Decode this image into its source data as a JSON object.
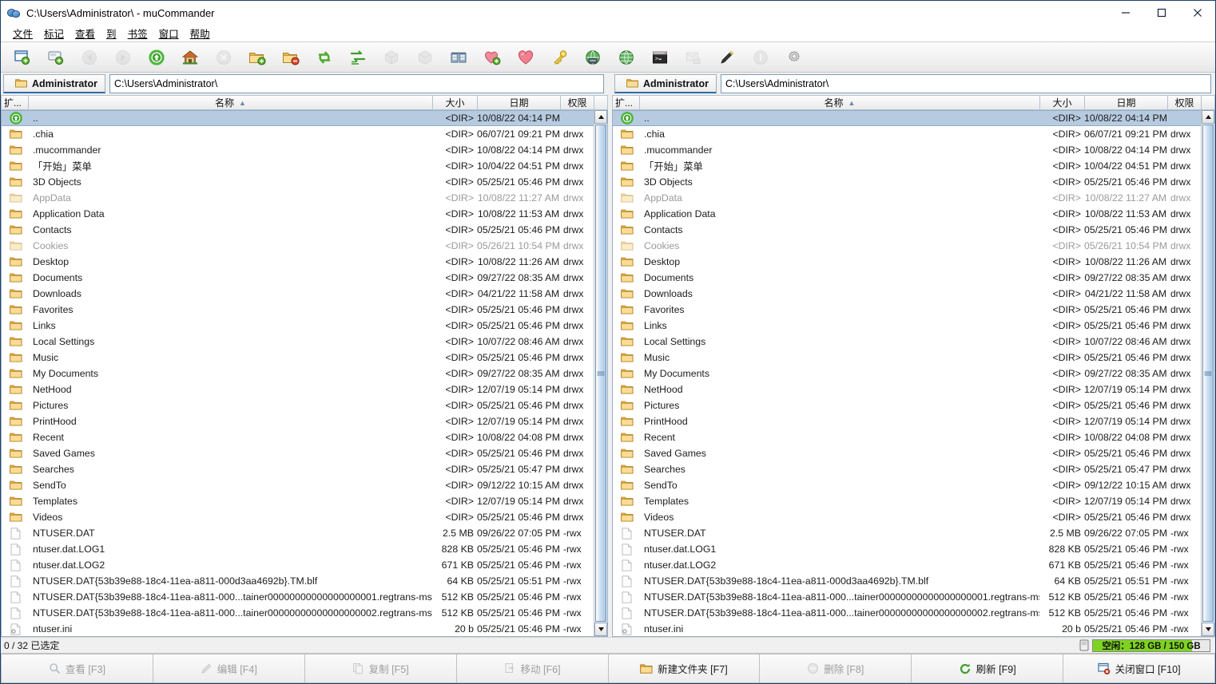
{
  "window": {
    "title": "C:\\Users\\Administrator\\ - muCommander",
    "icon": "mucommander-logo-icon",
    "controls": [
      {
        "name": "minimize-button",
        "glyph": "—"
      },
      {
        "name": "maximize-button",
        "glyph": "▢"
      },
      {
        "name": "close-button",
        "glyph": "✕"
      }
    ]
  },
  "menubar": {
    "items": [
      {
        "name": "menu-file",
        "label": "文件"
      },
      {
        "name": "menu-mark",
        "label": "标记"
      },
      {
        "name": "menu-view",
        "label": "查看"
      },
      {
        "name": "menu-goto",
        "label": "到"
      },
      {
        "name": "menu-bookmarks",
        "label": "书签"
      },
      {
        "name": "menu-window",
        "label": "窗口"
      },
      {
        "name": "menu-help",
        "label": "帮助"
      }
    ]
  },
  "toolbar": {
    "items": [
      {
        "name": "new-window-icon",
        "tip": "新建窗口",
        "enabled": true
      },
      {
        "name": "new-tab-icon",
        "tip": "新建标签",
        "enabled": true
      },
      {
        "name": "back-icon",
        "tip": "后退",
        "enabled": false
      },
      {
        "name": "forward-icon",
        "tip": "前进",
        "enabled": false
      },
      {
        "name": "parent-folder-icon",
        "tip": "上级目录",
        "enabled": true
      },
      {
        "name": "home-icon",
        "tip": "主目录",
        "enabled": true
      },
      {
        "name": "stop-icon",
        "tip": "停止",
        "enabled": false
      },
      {
        "name": "mark-folder-icon",
        "tip": "标记",
        "enabled": true
      },
      {
        "name": "unmark-folder-icon",
        "tip": "取消标记",
        "enabled": true
      },
      {
        "name": "swap-panels-icon",
        "tip": "交换面板",
        "enabled": true
      },
      {
        "name": "set-same-folder-icon",
        "tip": "同步目录",
        "enabled": true
      },
      {
        "name": "pack-icon",
        "tip": "打包",
        "enabled": false
      },
      {
        "name": "unpack-icon",
        "tip": "解包",
        "enabled": false
      },
      {
        "name": "compare-folders-icon",
        "tip": "比较文件夹",
        "enabled": true
      },
      {
        "name": "add-bookmark-icon",
        "tip": "添加书签",
        "enabled": true
      },
      {
        "name": "edit-bookmarks-icon",
        "tip": "编辑书签",
        "enabled": true
      },
      {
        "name": "credentials-icon",
        "tip": "凭据",
        "enabled": true
      },
      {
        "name": "connect-server-icon",
        "tip": "连接服务器",
        "enabled": true
      },
      {
        "name": "show-server-icon",
        "tip": "服务器",
        "enabled": true
      },
      {
        "name": "terminal-icon",
        "tip": "终端",
        "enabled": true
      },
      {
        "name": "email-icon",
        "tip": "发送邮件",
        "enabled": false
      },
      {
        "name": "properties-icon",
        "tip": "属性",
        "enabled": true
      },
      {
        "name": "info-icon",
        "tip": "信息",
        "enabled": false
      },
      {
        "name": "preferences-icon",
        "tip": "首选项",
        "enabled": true
      }
    ]
  },
  "columns": {
    "ext": "扩...",
    "name": "名称",
    "size": "大小",
    "date": "日期",
    "perm": "权限",
    "sort_indicator": "▲"
  },
  "panels": [
    {
      "id": "left-panel",
      "tab_label": "Administrator",
      "path": "C:\\Users\\Administrator\\",
      "active": true
    },
    {
      "id": "right-panel",
      "tab_label": "Administrator",
      "path": "C:\\Users\\Administrator\\",
      "active": false
    }
  ],
  "files": [
    {
      "icon": "parent-folder-icon",
      "name": "..",
      "size": "<DIR>",
      "date": "10/08/22 04:14 PM",
      "perm": "",
      "hidden": false,
      "selected": true,
      "type": "dir"
    },
    {
      "icon": "folder-icon",
      "name": ".chia",
      "size": "<DIR>",
      "date": "06/07/21 09:21 PM",
      "perm": "drwx",
      "hidden": false,
      "selected": false,
      "type": "dir"
    },
    {
      "icon": "folder-icon",
      "name": ".mucommander",
      "size": "<DIR>",
      "date": "10/08/22 04:14 PM",
      "perm": "drwx",
      "hidden": false,
      "selected": false,
      "type": "dir"
    },
    {
      "icon": "folder-icon",
      "name": "「开始」菜单",
      "size": "<DIR>",
      "date": "10/04/22 04:51 PM",
      "perm": "drwx",
      "hidden": false,
      "selected": false,
      "type": "dir"
    },
    {
      "icon": "folder-icon",
      "name": "3D Objects",
      "size": "<DIR>",
      "date": "05/25/21 05:46 PM",
      "perm": "drwx",
      "hidden": false,
      "selected": false,
      "type": "dir"
    },
    {
      "icon": "folder-icon",
      "name": "AppData",
      "size": "<DIR>",
      "date": "10/08/22 11:27 AM",
      "perm": "drwx",
      "hidden": true,
      "selected": false,
      "type": "dir"
    },
    {
      "icon": "folder-icon",
      "name": "Application Data",
      "size": "<DIR>",
      "date": "10/08/22 11:53 AM",
      "perm": "drwx",
      "hidden": false,
      "selected": false,
      "type": "dir"
    },
    {
      "icon": "folder-icon",
      "name": "Contacts",
      "size": "<DIR>",
      "date": "05/25/21 05:46 PM",
      "perm": "drwx",
      "hidden": false,
      "selected": false,
      "type": "dir"
    },
    {
      "icon": "folder-icon",
      "name": "Cookies",
      "size": "<DIR>",
      "date": "05/26/21 10:54 PM",
      "perm": "drwx",
      "hidden": true,
      "selected": false,
      "type": "dir"
    },
    {
      "icon": "folder-icon",
      "name": "Desktop",
      "size": "<DIR>",
      "date": "10/08/22 11:26 AM",
      "perm": "drwx",
      "hidden": false,
      "selected": false,
      "type": "dir"
    },
    {
      "icon": "folder-icon",
      "name": "Documents",
      "size": "<DIR>",
      "date": "09/27/22 08:35 AM",
      "perm": "drwx",
      "hidden": false,
      "selected": false,
      "type": "dir"
    },
    {
      "icon": "folder-icon",
      "name": "Downloads",
      "size": "<DIR>",
      "date": "04/21/22 11:58 AM",
      "perm": "drwx",
      "hidden": false,
      "selected": false,
      "type": "dir"
    },
    {
      "icon": "folder-icon",
      "name": "Favorites",
      "size": "<DIR>",
      "date": "05/25/21 05:46 PM",
      "perm": "drwx",
      "hidden": false,
      "selected": false,
      "type": "dir"
    },
    {
      "icon": "folder-icon",
      "name": "Links",
      "size": "<DIR>",
      "date": "05/25/21 05:46 PM",
      "perm": "drwx",
      "hidden": false,
      "selected": false,
      "type": "dir"
    },
    {
      "icon": "folder-icon",
      "name": "Local Settings",
      "size": "<DIR>",
      "date": "10/07/22 08:46 AM",
      "perm": "drwx",
      "hidden": false,
      "selected": false,
      "type": "dir"
    },
    {
      "icon": "folder-icon",
      "name": "Music",
      "size": "<DIR>",
      "date": "05/25/21 05:46 PM",
      "perm": "drwx",
      "hidden": false,
      "selected": false,
      "type": "dir"
    },
    {
      "icon": "folder-icon",
      "name": "My Documents",
      "size": "<DIR>",
      "date": "09/27/22 08:35 AM",
      "perm": "drwx",
      "hidden": false,
      "selected": false,
      "type": "dir"
    },
    {
      "icon": "folder-icon",
      "name": "NetHood",
      "size": "<DIR>",
      "date": "12/07/19 05:14 PM",
      "perm": "drwx",
      "hidden": false,
      "selected": false,
      "type": "dir"
    },
    {
      "icon": "folder-icon",
      "name": "Pictures",
      "size": "<DIR>",
      "date": "05/25/21 05:46 PM",
      "perm": "drwx",
      "hidden": false,
      "selected": false,
      "type": "dir"
    },
    {
      "icon": "folder-icon",
      "name": "PrintHood",
      "size": "<DIR>",
      "date": "12/07/19 05:14 PM",
      "perm": "drwx",
      "hidden": false,
      "selected": false,
      "type": "dir"
    },
    {
      "icon": "folder-icon",
      "name": "Recent",
      "size": "<DIR>",
      "date": "10/08/22 04:08 PM",
      "perm": "drwx",
      "hidden": false,
      "selected": false,
      "type": "dir"
    },
    {
      "icon": "folder-icon",
      "name": "Saved Games",
      "size": "<DIR>",
      "date": "05/25/21 05:46 PM",
      "perm": "drwx",
      "hidden": false,
      "selected": false,
      "type": "dir"
    },
    {
      "icon": "folder-icon",
      "name": "Searches",
      "size": "<DIR>",
      "date": "05/25/21 05:47 PM",
      "perm": "drwx",
      "hidden": false,
      "selected": false,
      "type": "dir"
    },
    {
      "icon": "folder-icon",
      "name": "SendTo",
      "size": "<DIR>",
      "date": "09/12/22 10:15 AM",
      "perm": "drwx",
      "hidden": false,
      "selected": false,
      "type": "dir"
    },
    {
      "icon": "folder-icon",
      "name": "Templates",
      "size": "<DIR>",
      "date": "12/07/19 05:14 PM",
      "perm": "drwx",
      "hidden": false,
      "selected": false,
      "type": "dir"
    },
    {
      "icon": "folder-icon",
      "name": "Videos",
      "size": "<DIR>",
      "date": "05/25/21 05:46 PM",
      "perm": "drwx",
      "hidden": false,
      "selected": false,
      "type": "dir"
    },
    {
      "icon": "file-icon",
      "name": "NTUSER.DAT",
      "size": "2.5 MB",
      "date": "09/26/22 07:05 PM",
      "perm": "-rwx",
      "hidden": false,
      "selected": false,
      "type": "file"
    },
    {
      "icon": "file-icon",
      "name": "ntuser.dat.LOG1",
      "size": "828 KB",
      "date": "05/25/21 05:46 PM",
      "perm": "-rwx",
      "hidden": false,
      "selected": false,
      "type": "file"
    },
    {
      "icon": "file-icon",
      "name": "ntuser.dat.LOG2",
      "size": "671 KB",
      "date": "05/25/21 05:46 PM",
      "perm": "-rwx",
      "hidden": false,
      "selected": false,
      "type": "file"
    },
    {
      "icon": "file-icon",
      "name": "NTUSER.DAT{53b39e88-18c4-11ea-a811-000d3aa4692b}.TM.blf",
      "size": "64 KB",
      "date": "05/25/21 05:51 PM",
      "perm": "-rwx",
      "hidden": false,
      "selected": false,
      "type": "file"
    },
    {
      "icon": "file-icon",
      "name": "NTUSER.DAT{53b39e88-18c4-11ea-a811-000...tainer00000000000000000001.regtrans-ms",
      "size": "512 KB",
      "date": "05/25/21 05:46 PM",
      "perm": "-rwx",
      "hidden": false,
      "selected": false,
      "type": "file"
    },
    {
      "icon": "file-icon",
      "name": "NTUSER.DAT{53b39e88-18c4-11ea-a811-000...tainer00000000000000000002.regtrans-ms",
      "size": "512 KB",
      "date": "05/25/21 05:46 PM",
      "perm": "-rwx",
      "hidden": false,
      "selected": false,
      "type": "file"
    },
    {
      "icon": "config-file-icon",
      "name": "ntuser.ini",
      "size": "20 b",
      "date": "05/25/21 05:46 PM",
      "perm": "-rwx",
      "hidden": false,
      "selected": false,
      "type": "file"
    }
  ],
  "statusbar": {
    "selection": "0 / 32 已选定",
    "drive_icon": "drive-icon",
    "free_space": "空闲：128 GB / 150 GB",
    "free_ratio_percent": 85
  },
  "function_buttons": [
    {
      "name": "view-button",
      "icon": "magnifier-icon",
      "label": "查看 [F3]",
      "enabled": false
    },
    {
      "name": "edit-button",
      "icon": "pencil-icon",
      "label": "编辑 [F4]",
      "enabled": false
    },
    {
      "name": "copy-button",
      "icon": "copy-icon",
      "label": "复制 [F5]",
      "enabled": false
    },
    {
      "name": "move-button",
      "icon": "move-icon",
      "label": "移动 [F6]",
      "enabled": false
    },
    {
      "name": "mkdir-button",
      "icon": "new-folder-icon",
      "label": "新建文件夹 [F7]",
      "enabled": true
    },
    {
      "name": "delete-button",
      "icon": "delete-icon",
      "label": "删除 [F8]",
      "enabled": false
    },
    {
      "name": "refresh-button",
      "icon": "refresh-icon",
      "label": "刷新 [F9]",
      "enabled": true
    },
    {
      "name": "close-window-button",
      "icon": "close-window-icon",
      "label": "关闭窗口 [F10]",
      "enabled": true
    }
  ]
}
